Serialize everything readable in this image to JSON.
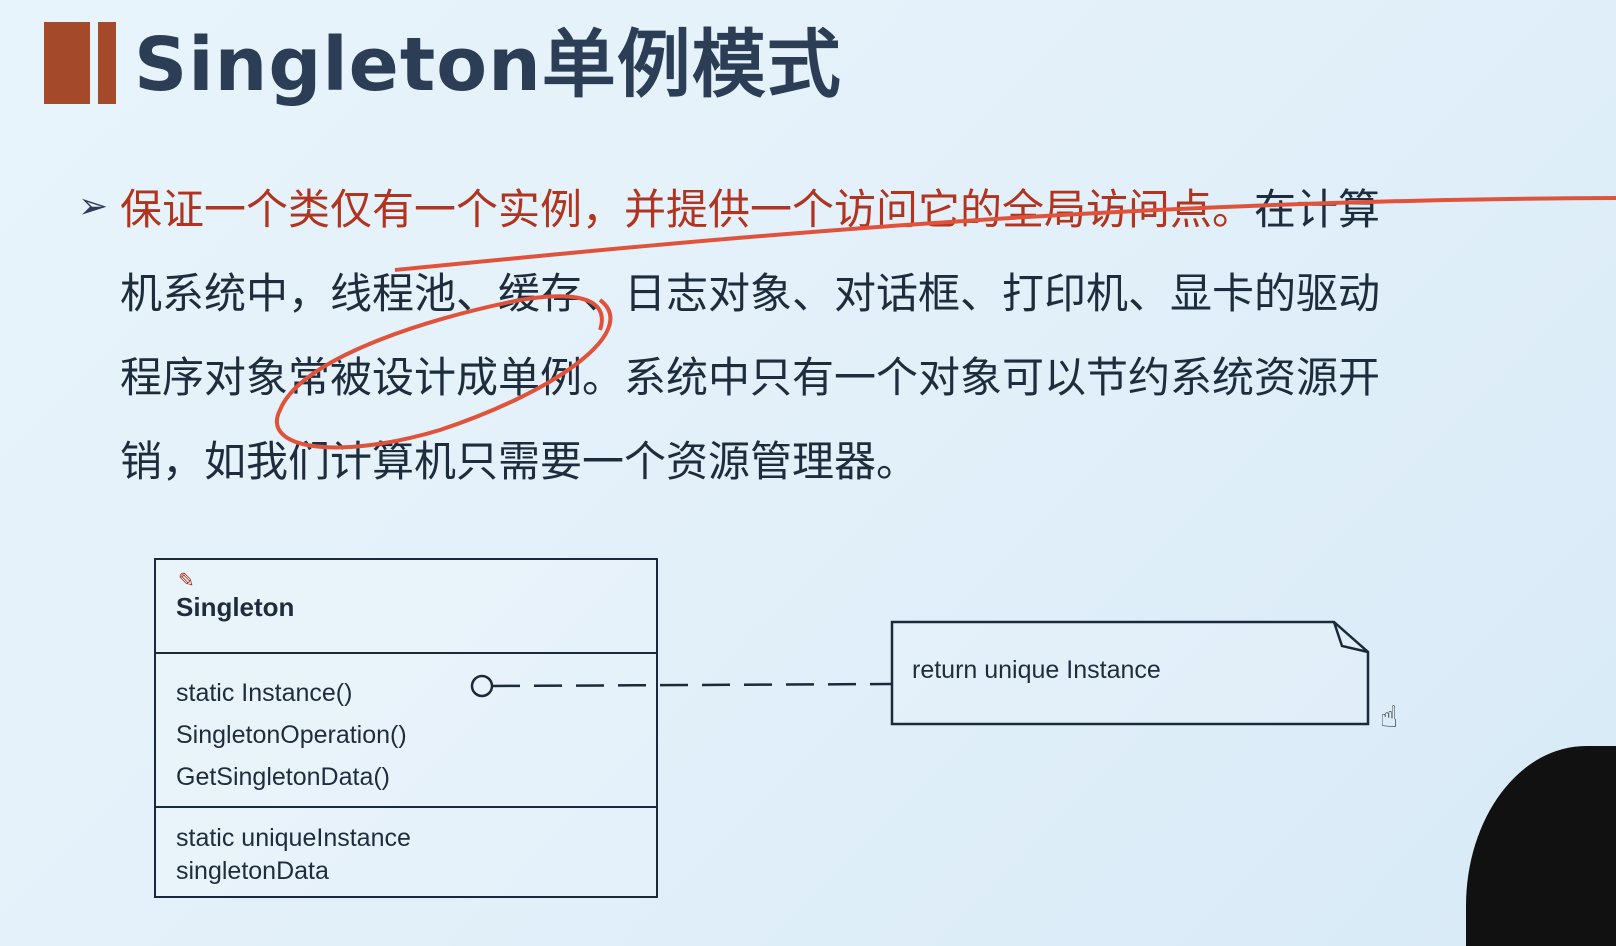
{
  "slide": {
    "title": "Singleton单例模式",
    "bullet": {
      "lead": "保证一个类仅有一个实例，并提供一个访问它的全局访问点。",
      "line1_rest": "在计算",
      "line2": "机系统中，线程池、缓存、日志对象、对话框、打印机、显卡的驱动",
      "line3": "程序对象常被设计成单例。系统中只有一个对象可以节约系统资源开",
      "line4": "销，如我们计算机只需要一个资源管理器。"
    }
  },
  "uml": {
    "class_name": "Singleton",
    "operations": [
      "static Instance()",
      "SingletonOperation()",
      "GetSingletonData()"
    ],
    "attributes": [
      "static uniqueInstance",
      "singletonData"
    ],
    "note": "return unique Instance"
  },
  "colors": {
    "accent": "#a44a2a",
    "annotation": "#e0533a",
    "lead_text": "#b0341f"
  }
}
